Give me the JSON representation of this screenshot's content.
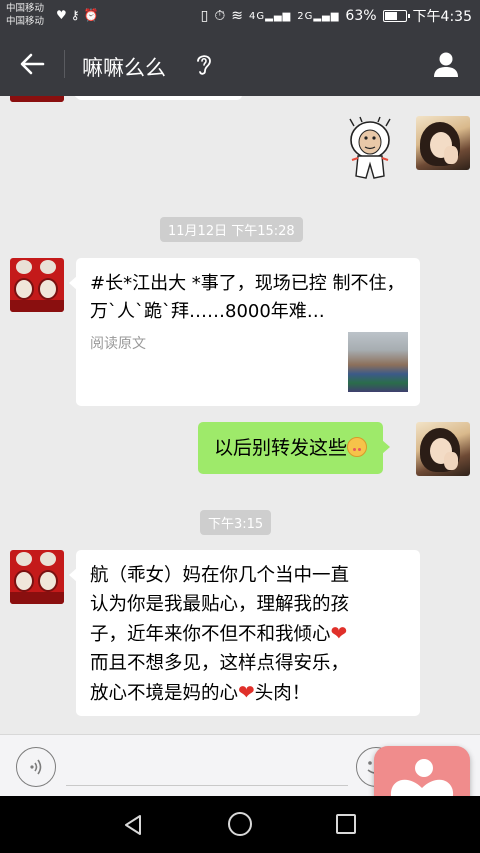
{
  "status_bar": {
    "carrier_1": "中国移动",
    "carrier_2": "中国移动",
    "battery_text": "63%",
    "battery_level": 0.63,
    "time": "下午4:35",
    "network_1": "4G",
    "network_2": "2G"
  },
  "header": {
    "title": "嘛嘛么么",
    "back_icon": "arrow-left-icon",
    "mode_icon": "ear-icon",
    "contact_icon": "person-icon"
  },
  "messages": {
    "timestamp_1": "11月12日 下午15:28",
    "link_card": {
      "title": "#长*江出大 *事了，现场已控 制不住，万`人`跪`拜……8000年难…",
      "subtitle": "阅读原文"
    },
    "my_reply": "以后别转发这些",
    "timestamp_2": "下午3:15",
    "long_message": {
      "line1": "航（乖女）妈在你几个当中一直",
      "line2": "认为你是我最贴心，理解我的孩",
      "line3a": "子，近年来你不但不和我倾心",
      "line4": "而且不想多见，这样点得安乐，",
      "line5a": "放心不境是妈的心",
      "line5b": "头肉！",
      "heart": "❤"
    }
  },
  "input_bar": {
    "voice_icon": "voice-icon",
    "emoji_icon": "emoji-icon",
    "plus_icon": "plus-icon"
  },
  "colors": {
    "header_bg": "#393a3f",
    "chat_bg": "#ebebeb",
    "my_bubble": "#9eea6a",
    "their_bubble": "#ffffff"
  }
}
